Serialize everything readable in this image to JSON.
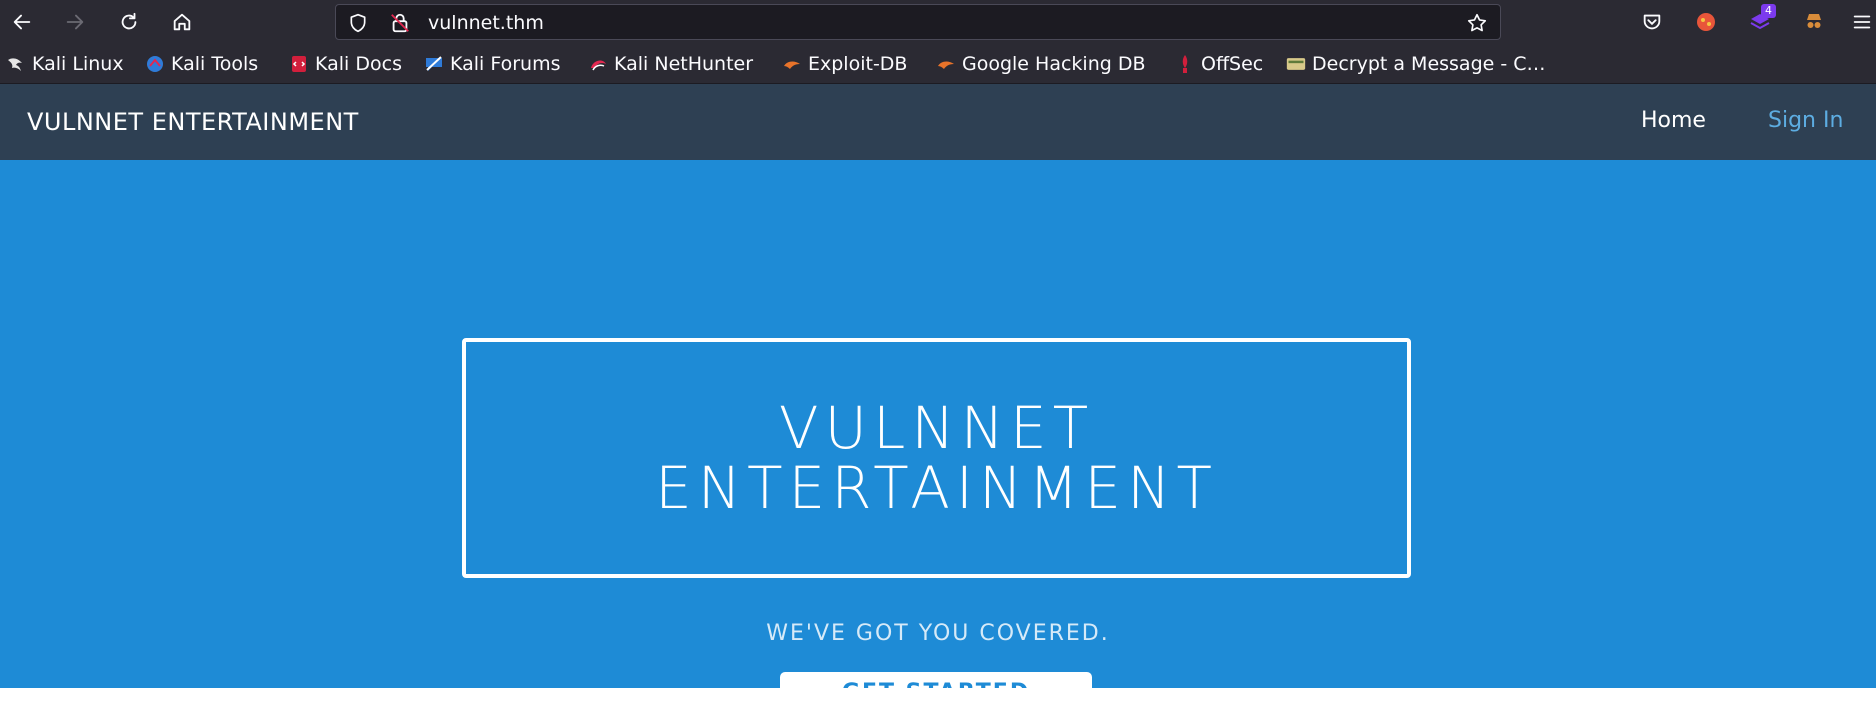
{
  "browser": {
    "url": "vulnnet.thm",
    "extension_badge": "4",
    "bookmarks": [
      {
        "label": "Kali Linux",
        "icon": "kali-dragon-icon"
      },
      {
        "label": "Kali Tools",
        "icon": "kali-tools-icon"
      },
      {
        "label": "Kali Docs",
        "icon": "kali-docs-icon"
      },
      {
        "label": "Kali Forums",
        "icon": "kali-forums-icon"
      },
      {
        "label": "Kali NetHunter",
        "icon": "nethunter-icon"
      },
      {
        "label": "Exploit-DB",
        "icon": "exploit-db-icon"
      },
      {
        "label": "Google Hacking DB",
        "icon": "ghdb-icon"
      },
      {
        "label": "OffSec",
        "icon": "offsec-icon"
      },
      {
        "label": "Decrypt a Message - C…",
        "icon": "decrypt-icon"
      }
    ]
  },
  "site": {
    "brand": "VULNNET ENTERTAINMENT",
    "nav": {
      "home": "Home",
      "sign_in": "Sign In"
    },
    "hero": {
      "title_line1": "VULNNET",
      "title_line2": "ENTERTAINMENT",
      "subtitle": "WE'VE GOT YOU COVERED.",
      "cta": "GET STARTED"
    }
  },
  "colors": {
    "chrome": "#2b2a33",
    "nav_bg": "#2e4053",
    "hero_bg": "#1e8bd6",
    "sign_in": "#5dade2"
  }
}
